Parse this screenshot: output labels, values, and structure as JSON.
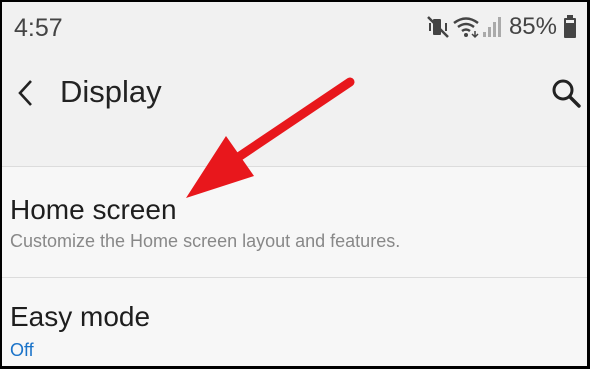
{
  "status_bar": {
    "time": "4:57",
    "battery_percent": "85%",
    "icons": [
      "vibrate-mute-icon",
      "wifi-icon",
      "signal-icon",
      "battery-icon"
    ]
  },
  "app_bar": {
    "title": "Display",
    "back_icon": "back-arrow-icon",
    "search_icon": "search-icon"
  },
  "settings": {
    "items": [
      {
        "title": "Home screen",
        "subtitle": "Customize the Home screen layout and features."
      },
      {
        "title": "Easy mode",
        "subtitle": "Off"
      }
    ]
  },
  "annotation": {
    "color": "#e8171c",
    "icon": "red-pointer-arrow"
  },
  "colors": {
    "link_blue": "#1a73c9",
    "background": "#f3f3f3"
  }
}
